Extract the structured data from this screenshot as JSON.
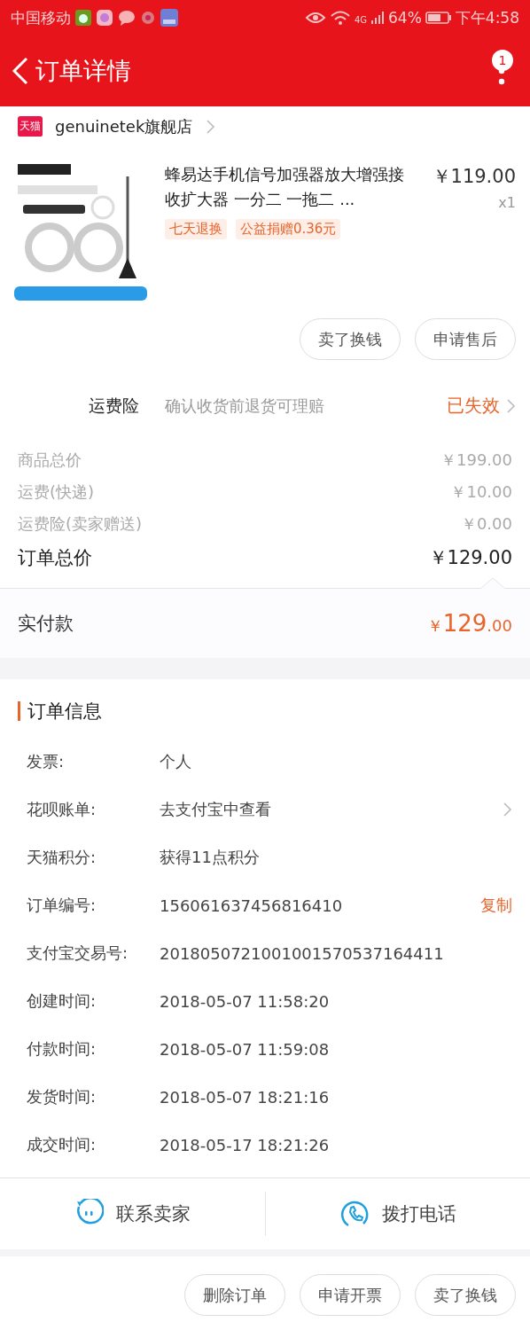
{
  "status_bar": {
    "carrier": "中国移动",
    "network": "4G",
    "battery": "64%",
    "time": "下午4:58"
  },
  "header": {
    "title": "订单详情",
    "badge": "1"
  },
  "shop": {
    "logo_text": "天猫",
    "name": "genuinetek旗舰店"
  },
  "product": {
    "image": {
      "kind": "picture"
    },
    "title": "蜂易达手机信号加强器放大增强接收扩大器 一分二 一拖二 ...",
    "price": "￥119.00",
    "quantity": "x1",
    "tags": [
      "七天退换",
      "公益捐赠0.36元"
    ]
  },
  "product_buttons": [
    "卖了换钱",
    "申请售后"
  ],
  "insurance": {
    "label": "运费险",
    "description": "确认收货前退货可理赔",
    "status": "已失效"
  },
  "costs": [
    {
      "label": "商品总价",
      "value": "￥199.00",
      "kind": "minor"
    },
    {
      "label": "运费(快递)",
      "value": "￥10.00",
      "kind": "minor"
    },
    {
      "label": "运费险(卖家赠送)",
      "value": "￥0.00",
      "kind": "minor"
    },
    {
      "label": "订单总价",
      "value": "￥129.00",
      "kind": "total"
    }
  ],
  "paid": {
    "label": "实付款",
    "currency": "￥",
    "integer": "129",
    "decimal": ".00"
  },
  "order_info": {
    "title": "订单信息",
    "rows": [
      {
        "label": "发票:",
        "value": "个人",
        "chevron": false
      },
      {
        "label": "花呗账单:",
        "value": "去支付宝中查看",
        "chevron": true
      },
      {
        "label": "天猫积分:",
        "value": "获得11点积分",
        "chevron": false
      },
      {
        "label": "订单编号:",
        "value": "156061637456816410",
        "action": "复制",
        "chevron": false
      },
      {
        "label": "支付宝交易号:",
        "value": "2018050721001001570537164411",
        "chevron": false
      },
      {
        "label": "创建时间:",
        "value": "2018-05-07 11:58:20",
        "chevron": false
      },
      {
        "label": "付款时间:",
        "value": "2018-05-07 11:59:08",
        "chevron": false
      },
      {
        "label": "发货时间:",
        "value": "2018-05-07 18:21:16",
        "chevron": false
      },
      {
        "label": "成交时间:",
        "value": "2018-05-17 18:21:26",
        "chevron": false
      }
    ]
  },
  "contact": [
    {
      "label": "联系卖家",
      "kind": "chat"
    },
    {
      "label": "拨打电话",
      "kind": "phone"
    }
  ],
  "bottom_buttons": [
    "删除订单",
    "申请开票",
    "卖了换钱"
  ]
}
